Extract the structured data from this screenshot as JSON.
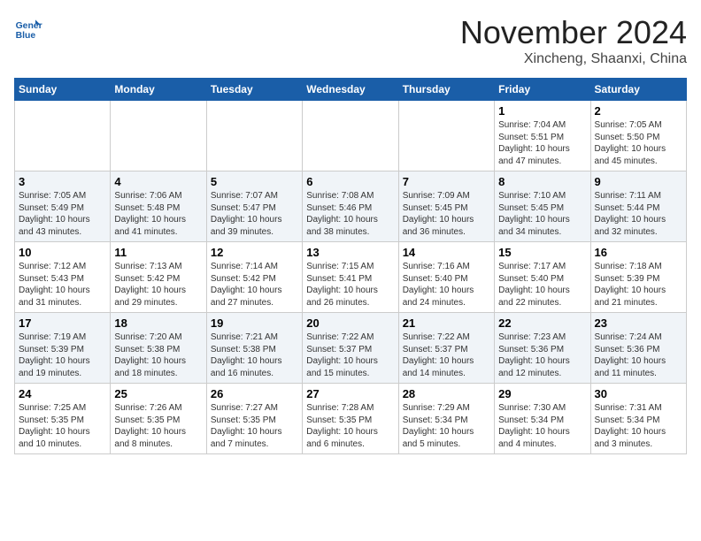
{
  "header": {
    "logo_line1": "General",
    "logo_line2": "Blue",
    "month_title": "November 2024",
    "subtitle": "Xincheng, Shaanxi, China"
  },
  "weekdays": [
    "Sunday",
    "Monday",
    "Tuesday",
    "Wednesday",
    "Thursday",
    "Friday",
    "Saturday"
  ],
  "weeks": [
    [
      {
        "day": "",
        "info": ""
      },
      {
        "day": "",
        "info": ""
      },
      {
        "day": "",
        "info": ""
      },
      {
        "day": "",
        "info": ""
      },
      {
        "day": "",
        "info": ""
      },
      {
        "day": "1",
        "info": "Sunrise: 7:04 AM\nSunset: 5:51 PM\nDaylight: 10 hours and 47 minutes."
      },
      {
        "day": "2",
        "info": "Sunrise: 7:05 AM\nSunset: 5:50 PM\nDaylight: 10 hours and 45 minutes."
      }
    ],
    [
      {
        "day": "3",
        "info": "Sunrise: 7:05 AM\nSunset: 5:49 PM\nDaylight: 10 hours and 43 minutes."
      },
      {
        "day": "4",
        "info": "Sunrise: 7:06 AM\nSunset: 5:48 PM\nDaylight: 10 hours and 41 minutes."
      },
      {
        "day": "5",
        "info": "Sunrise: 7:07 AM\nSunset: 5:47 PM\nDaylight: 10 hours and 39 minutes."
      },
      {
        "day": "6",
        "info": "Sunrise: 7:08 AM\nSunset: 5:46 PM\nDaylight: 10 hours and 38 minutes."
      },
      {
        "day": "7",
        "info": "Sunrise: 7:09 AM\nSunset: 5:45 PM\nDaylight: 10 hours and 36 minutes."
      },
      {
        "day": "8",
        "info": "Sunrise: 7:10 AM\nSunset: 5:45 PM\nDaylight: 10 hours and 34 minutes."
      },
      {
        "day": "9",
        "info": "Sunrise: 7:11 AM\nSunset: 5:44 PM\nDaylight: 10 hours and 32 minutes."
      }
    ],
    [
      {
        "day": "10",
        "info": "Sunrise: 7:12 AM\nSunset: 5:43 PM\nDaylight: 10 hours and 31 minutes."
      },
      {
        "day": "11",
        "info": "Sunrise: 7:13 AM\nSunset: 5:42 PM\nDaylight: 10 hours and 29 minutes."
      },
      {
        "day": "12",
        "info": "Sunrise: 7:14 AM\nSunset: 5:42 PM\nDaylight: 10 hours and 27 minutes."
      },
      {
        "day": "13",
        "info": "Sunrise: 7:15 AM\nSunset: 5:41 PM\nDaylight: 10 hours and 26 minutes."
      },
      {
        "day": "14",
        "info": "Sunrise: 7:16 AM\nSunset: 5:40 PM\nDaylight: 10 hours and 24 minutes."
      },
      {
        "day": "15",
        "info": "Sunrise: 7:17 AM\nSunset: 5:40 PM\nDaylight: 10 hours and 22 minutes."
      },
      {
        "day": "16",
        "info": "Sunrise: 7:18 AM\nSunset: 5:39 PM\nDaylight: 10 hours and 21 minutes."
      }
    ],
    [
      {
        "day": "17",
        "info": "Sunrise: 7:19 AM\nSunset: 5:39 PM\nDaylight: 10 hours and 19 minutes."
      },
      {
        "day": "18",
        "info": "Sunrise: 7:20 AM\nSunset: 5:38 PM\nDaylight: 10 hours and 18 minutes."
      },
      {
        "day": "19",
        "info": "Sunrise: 7:21 AM\nSunset: 5:38 PM\nDaylight: 10 hours and 16 minutes."
      },
      {
        "day": "20",
        "info": "Sunrise: 7:22 AM\nSunset: 5:37 PM\nDaylight: 10 hours and 15 minutes."
      },
      {
        "day": "21",
        "info": "Sunrise: 7:22 AM\nSunset: 5:37 PM\nDaylight: 10 hours and 14 minutes."
      },
      {
        "day": "22",
        "info": "Sunrise: 7:23 AM\nSunset: 5:36 PM\nDaylight: 10 hours and 12 minutes."
      },
      {
        "day": "23",
        "info": "Sunrise: 7:24 AM\nSunset: 5:36 PM\nDaylight: 10 hours and 11 minutes."
      }
    ],
    [
      {
        "day": "24",
        "info": "Sunrise: 7:25 AM\nSunset: 5:35 PM\nDaylight: 10 hours and 10 minutes."
      },
      {
        "day": "25",
        "info": "Sunrise: 7:26 AM\nSunset: 5:35 PM\nDaylight: 10 hours and 8 minutes."
      },
      {
        "day": "26",
        "info": "Sunrise: 7:27 AM\nSunset: 5:35 PM\nDaylight: 10 hours and 7 minutes."
      },
      {
        "day": "27",
        "info": "Sunrise: 7:28 AM\nSunset: 5:35 PM\nDaylight: 10 hours and 6 minutes."
      },
      {
        "day": "28",
        "info": "Sunrise: 7:29 AM\nSunset: 5:34 PM\nDaylight: 10 hours and 5 minutes."
      },
      {
        "day": "29",
        "info": "Sunrise: 7:30 AM\nSunset: 5:34 PM\nDaylight: 10 hours and 4 minutes."
      },
      {
        "day": "30",
        "info": "Sunrise: 7:31 AM\nSunset: 5:34 PM\nDaylight: 10 hours and 3 minutes."
      }
    ]
  ]
}
